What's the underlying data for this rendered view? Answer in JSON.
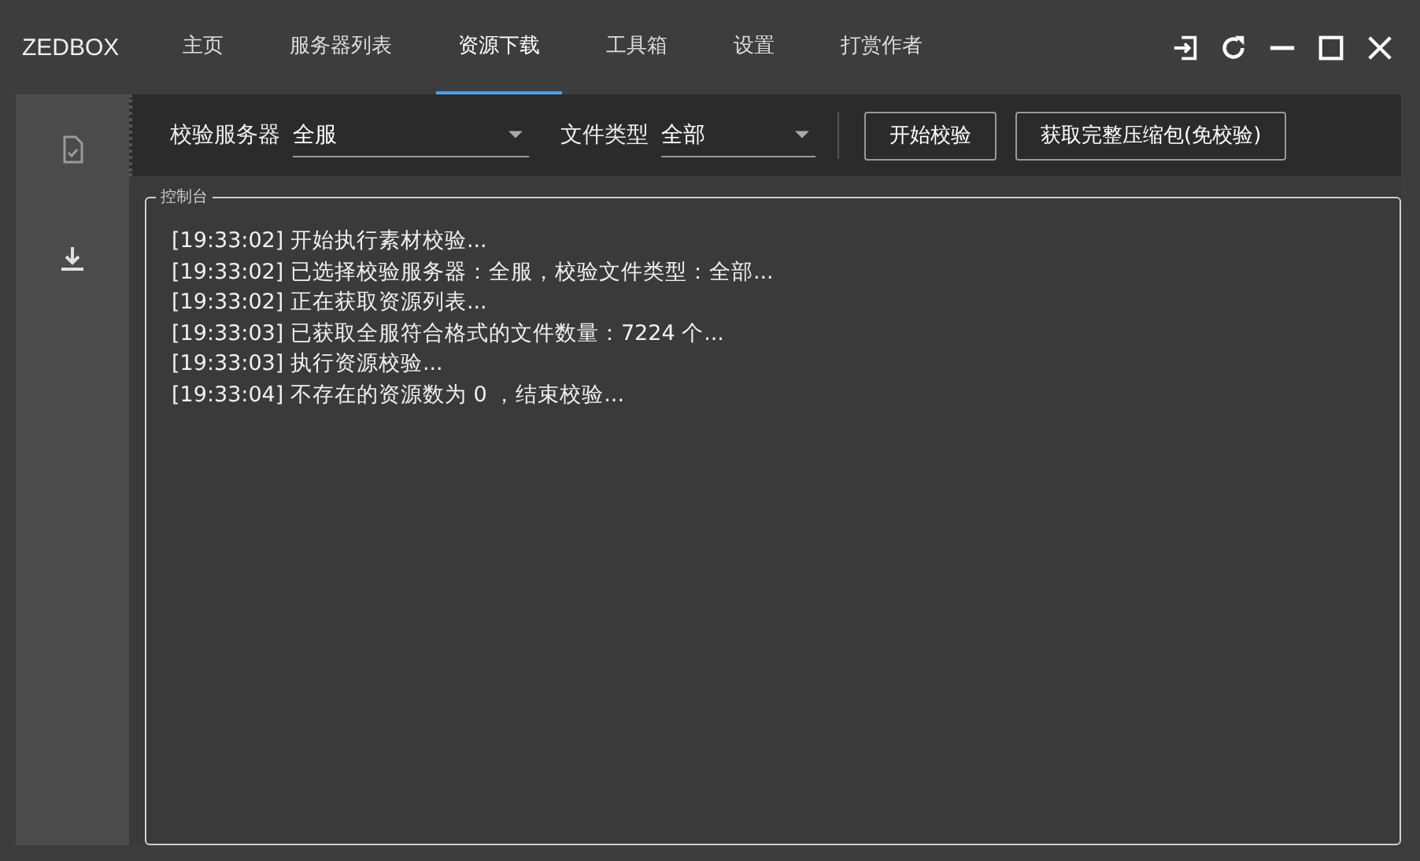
{
  "window": {
    "title": "ZEDBOX"
  },
  "tabs": [
    {
      "label": "主页",
      "selected": false
    },
    {
      "label": "服务器列表",
      "selected": false
    },
    {
      "label": "资源下载",
      "selected": true
    },
    {
      "label": "工具箱",
      "selected": false
    },
    {
      "label": "设置",
      "selected": false
    },
    {
      "label": "打赏作者",
      "selected": false
    }
  ],
  "sidebar": {
    "items": [
      {
        "kind": "document",
        "selected": false
      },
      {
        "kind": "download",
        "selected": true
      }
    ]
  },
  "toolbar": {
    "server_label": "校验服务器",
    "server_value": "全服",
    "type_label": "文件类型",
    "type_value": "全部",
    "buttons": [
      "开始校验",
      "获取完整压缩包(免校验)"
    ]
  },
  "console": {
    "title": "控制台",
    "lines": [
      "[19:33:02] 开始执行素材校验...",
      "[19:33:02] 已选择校验服务器：全服，校验文件类型：全部...",
      "[19:33:02] 正在获取资源列表...",
      "[19:33:03] 已获取全服符合格式的文件数量：7224 个...",
      "[19:33:03] 执行资源校验...",
      "[19:33:04] 不存在的资源数为 0 ，结束校验..."
    ]
  }
}
